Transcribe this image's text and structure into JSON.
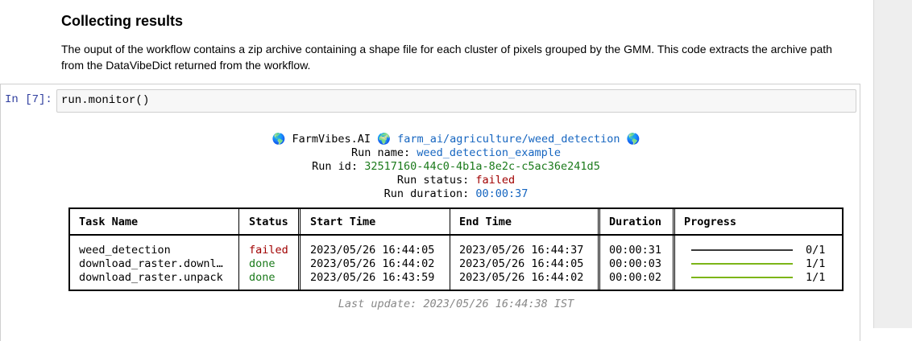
{
  "markdown": {
    "heading": "Collecting results",
    "paragraph": "The ouput of the workflow contains a zip archive containing a shape file for each cluster of pixels grouped by the GMM. This code extracts the archive path from the DataVibeDict returned from the workflow."
  },
  "cell": {
    "prompt": "In [7]:",
    "code": "run.monitor()"
  },
  "output": {
    "brand": "FarmVibes.AI",
    "workflow": "farm_ai/agriculture/weed_detection",
    "run_name_label": "Run name:",
    "run_name": "weed_detection_example",
    "run_id_label": "Run id:",
    "run_id": "32517160-44c0-4b1a-8e2c-c5ac36e241d5",
    "run_status_label": "Run status:",
    "run_status": "failed",
    "run_duration_label": "Run duration:",
    "run_duration": "00:00:37",
    "table": {
      "headers": [
        "Task Name",
        "Status",
        "Start Time",
        "End Time",
        "Duration",
        "Progress"
      ],
      "rows": [
        {
          "task": "weed_detection",
          "status": "failed",
          "start": "2023/05/26 16:44:05",
          "end": "2023/05/26 16:44:37",
          "duration": "00:00:31",
          "progress_text": "0/1",
          "progress_fraction": 0.0
        },
        {
          "task": "download_raster.downl…",
          "status": "done",
          "start": "2023/05/26 16:44:02",
          "end": "2023/05/26 16:44:05",
          "duration": "00:00:03",
          "progress_text": "1/1",
          "progress_fraction": 1.0
        },
        {
          "task": "download_raster.unpack",
          "status": "done",
          "start": "2023/05/26 16:43:59",
          "end": "2023/05/26 16:44:02",
          "duration": "00:00:02",
          "progress_text": "1/1",
          "progress_fraction": 1.0
        }
      ]
    },
    "last_update": "Last update: 2023/05/26 16:44:38 IST"
  },
  "colors": {
    "failed": "#a10000",
    "done": "#1b7a1b",
    "progress_done": "#7cb518",
    "progress_pending": "#3a3a3a",
    "link": "#1565c0"
  }
}
